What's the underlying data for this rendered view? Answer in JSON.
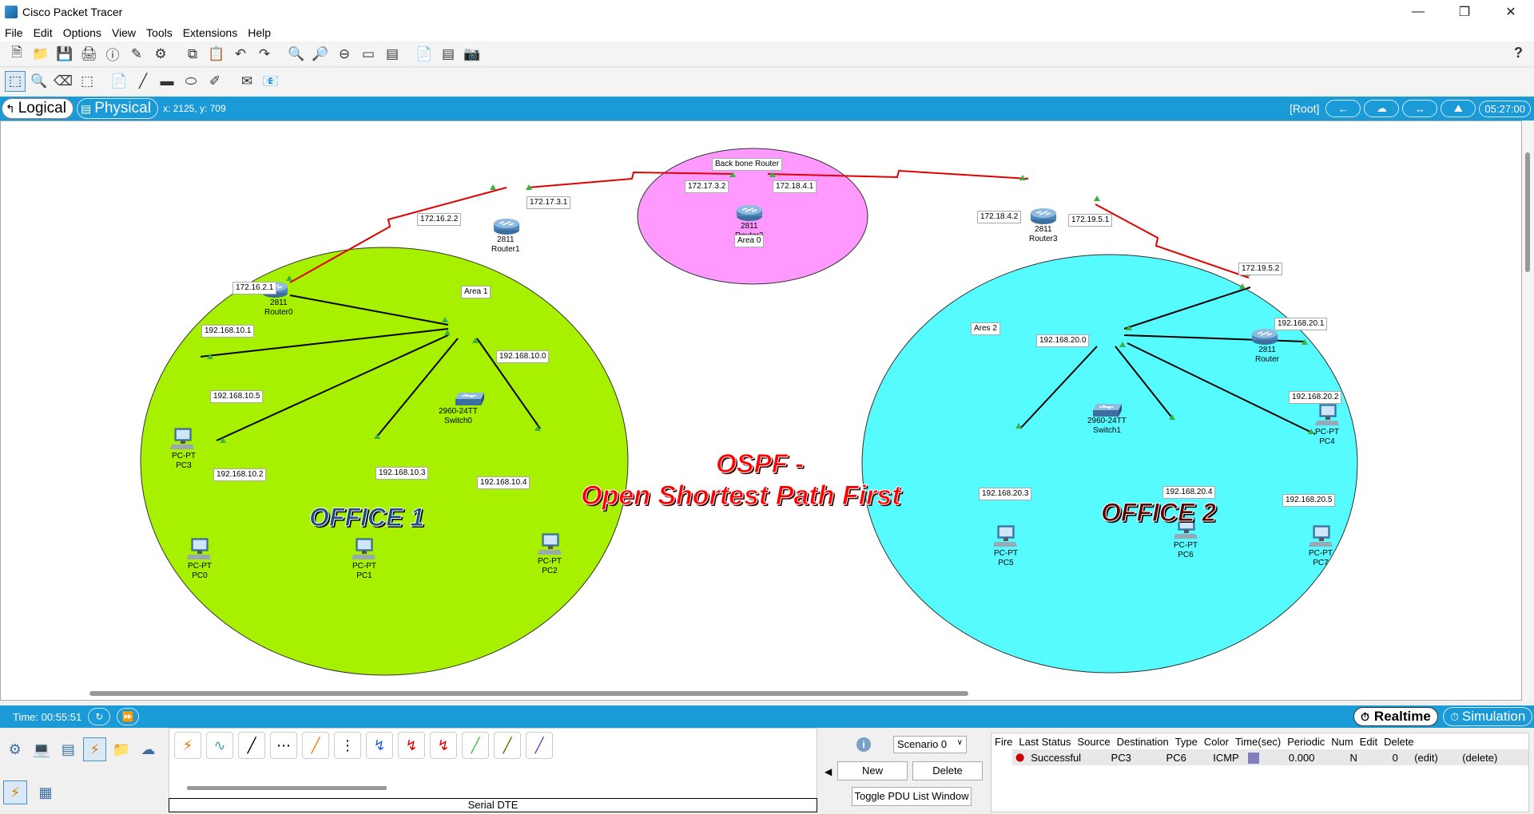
{
  "window": {
    "title": "Cisco Packet Tracer"
  },
  "menu": [
    "File",
    "Edit",
    "Options",
    "View",
    "Tools",
    "Extensions",
    "Help"
  ],
  "modebar": {
    "logical": "Logical",
    "physical": "Physical",
    "coords": "x: 2125, y: 709",
    "root": "[Root]",
    "clock": "05:27:00"
  },
  "topology": {
    "title_line1": "OSPF -",
    "title_line2": "Open Shortest Path First",
    "office1": "OFFICE 1",
    "office2": "OFFICE 2",
    "backbone_label": "Back bone Router",
    "area0": "Area 0",
    "area1": "Area 1",
    "area2": "Ares 2",
    "routers": {
      "r0": {
        "model": "2811",
        "name": "Router0"
      },
      "r1": {
        "model": "2811",
        "name": "Router1"
      },
      "r2": {
        "model": "2811",
        "name": "Router2"
      },
      "r3": {
        "model": "2811",
        "name": "Router3"
      },
      "r4": {
        "model": "2811",
        "name": "Router"
      }
    },
    "switches": {
      "s0": {
        "model": "2960-24TT",
        "name": "Switch0"
      },
      "s1": {
        "model": "2960-24TT",
        "name": "Switch1"
      }
    },
    "pcs": {
      "pc0": {
        "type": "PC-PT",
        "name": "PC0"
      },
      "pc1": {
        "type": "PC-PT",
        "name": "PC1"
      },
      "pc2": {
        "type": "PC-PT",
        "name": "PC2"
      },
      "pc3": {
        "type": "PC-PT",
        "name": "PC3"
      },
      "pc4": {
        "type": "PC-PT",
        "name": "PC4"
      },
      "pc5": {
        "type": "PC-PT",
        "name": "PC5"
      },
      "pc6": {
        "type": "PC-PT",
        "name": "PC6"
      },
      "pc7": {
        "type": "PC-PT",
        "name": "PC7"
      }
    },
    "ip_labels": {
      "r1_left": "172.16.2.2",
      "r1_right": "172.17.3.1",
      "r2_left": "172.17.3.2",
      "r2_right": "172.18.4.1",
      "r3_left": "172.18.4.2",
      "r3_right": "172.19.5.1",
      "r4_top": "172.19.5.2",
      "r4_lan": "192.168.20.1",
      "r0_wan": "172.16.2.1",
      "r0_lan": "192.168.10.1",
      "net1": "192.168.10.0",
      "net2": "192.168.20.0",
      "pc3_ip": "192.168.10.5",
      "pc0_ip": "192.168.10.2",
      "pc1_ip": "192.168.10.3",
      "pc2_ip": "192.168.10.4",
      "pc4_ip": "192.168.20.2",
      "pc5_ip": "192.168.20.3",
      "pc6_ip": "192.168.20.4",
      "pc7_ip": "192.168.20.5"
    }
  },
  "bottom": {
    "time": "Time: 00:55:51",
    "realtime": "Realtime",
    "simulation": "Simulation",
    "connection_label": "Serial DTE",
    "scenario": "Scenario 0",
    "new_btn": "New",
    "delete_btn": "Delete",
    "toggle_btn": "Toggle PDU List Window",
    "pdu_headers": [
      "Fire",
      "Last Status",
      "Source",
      "Destination",
      "Type",
      "Color",
      "Time(sec)",
      "Periodic",
      "Num",
      "Edit",
      "Delete"
    ],
    "pdu_row": {
      "status": "Successful",
      "source": "PC3",
      "destination": "PC6",
      "type": "ICMP",
      "color": "#8080c0",
      "time": "0.000",
      "periodic": "N",
      "num": "0",
      "edit": "(edit)",
      "delete": "(delete)"
    }
  },
  "colors": {
    "area1": "#a6f000",
    "area2": "#55fbff",
    "area0": "#ff99ff",
    "serial": "#e00000",
    "accent": "#1a9ad6"
  }
}
